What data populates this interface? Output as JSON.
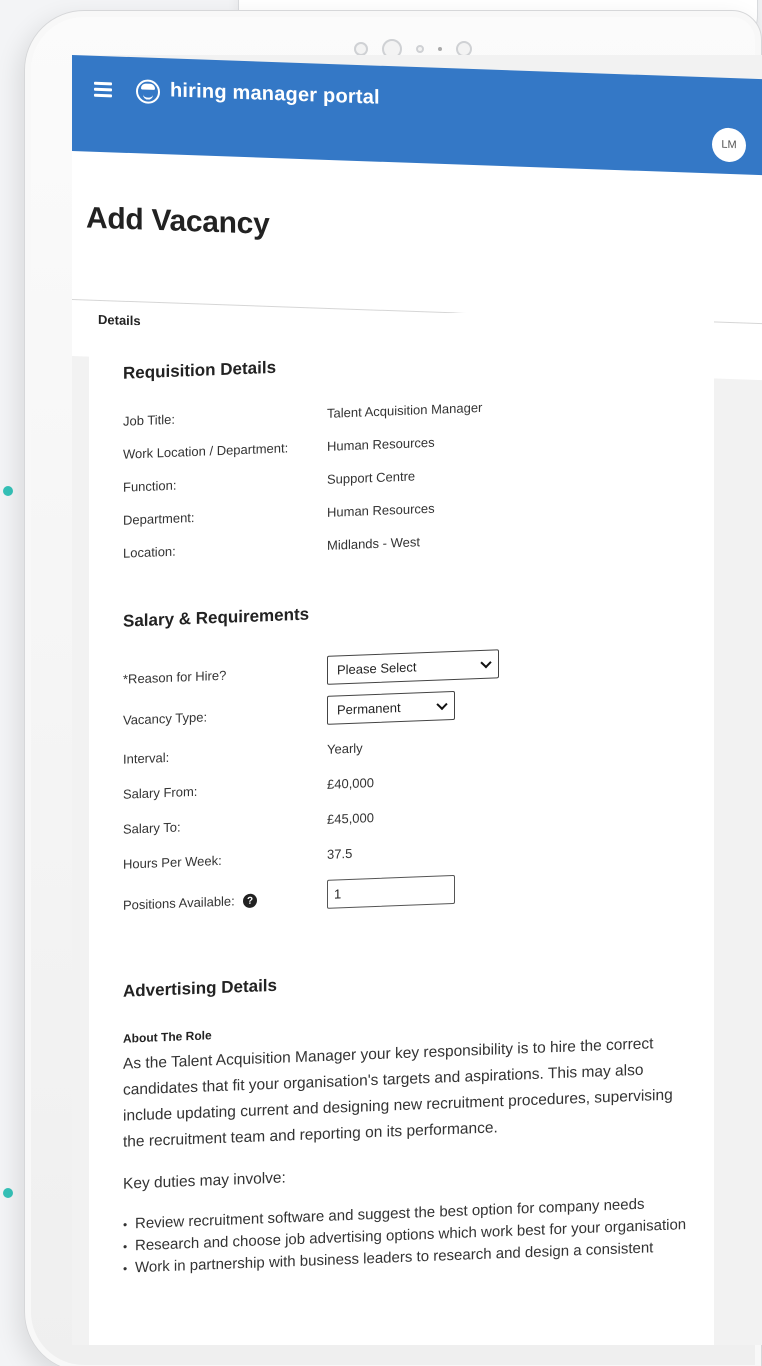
{
  "app": {
    "name": "hiring manager portal",
    "user_initials": "LM"
  },
  "page": {
    "title": "Add Vacancy",
    "tabs": [
      {
        "label": "Details",
        "active": true
      }
    ]
  },
  "requisition": {
    "title": "Requisition Details",
    "rows": [
      {
        "label": "Job Title:",
        "value": "Talent Acquisition Manager"
      },
      {
        "label": "Work Location / Department:",
        "value": "Human Resources"
      },
      {
        "label": "Function:",
        "value": "Support Centre"
      },
      {
        "label": "Department:",
        "value": "Human Resources"
      },
      {
        "label": "Location:",
        "value": "Midlands - West"
      }
    ]
  },
  "salary": {
    "title": "Salary & Requirements",
    "reason_label": "*Reason for Hire?",
    "reason_value": "Please Select",
    "vacancy_type_label": "Vacancy Type:",
    "vacancy_type_value": "Permanent",
    "interval_label": "Interval:",
    "interval_value": "Yearly",
    "salary_from_label": "Salary From:",
    "salary_from_value": "£40,000",
    "salary_to_label": "Salary To:",
    "salary_to_value": "£45,000",
    "hours_label": "Hours Per Week:",
    "hours_value": "37.5",
    "positions_label": "Positions Available:",
    "positions_value": "1"
  },
  "advertising": {
    "title": "Advertising Details",
    "about_title": "About The Role",
    "about_text": "As the Talent Acquisition Manager your key responsibility is to hire the correct candidates that fit your organisation's targets and aspirations. This may also include updating current and designing new recruitment procedures, supervising the recruitment team and reporting on its performance.",
    "duties_intro": "Key duties may involve:",
    "duties": [
      "Review recruitment software and suggest the best option for company needs",
      "Research and choose job advertising options which work best for your organisation",
      "Work in partnership with business leaders to research and design a consistent"
    ]
  },
  "colors": {
    "header": "#3478c6",
    "accent_dots": "#35c2b8"
  },
  "icons": {
    "menu": "hamburger-icon",
    "logo": "smiley-logo-icon",
    "help": "question-circle-icon",
    "dropdown": "chevron-down-icon"
  }
}
